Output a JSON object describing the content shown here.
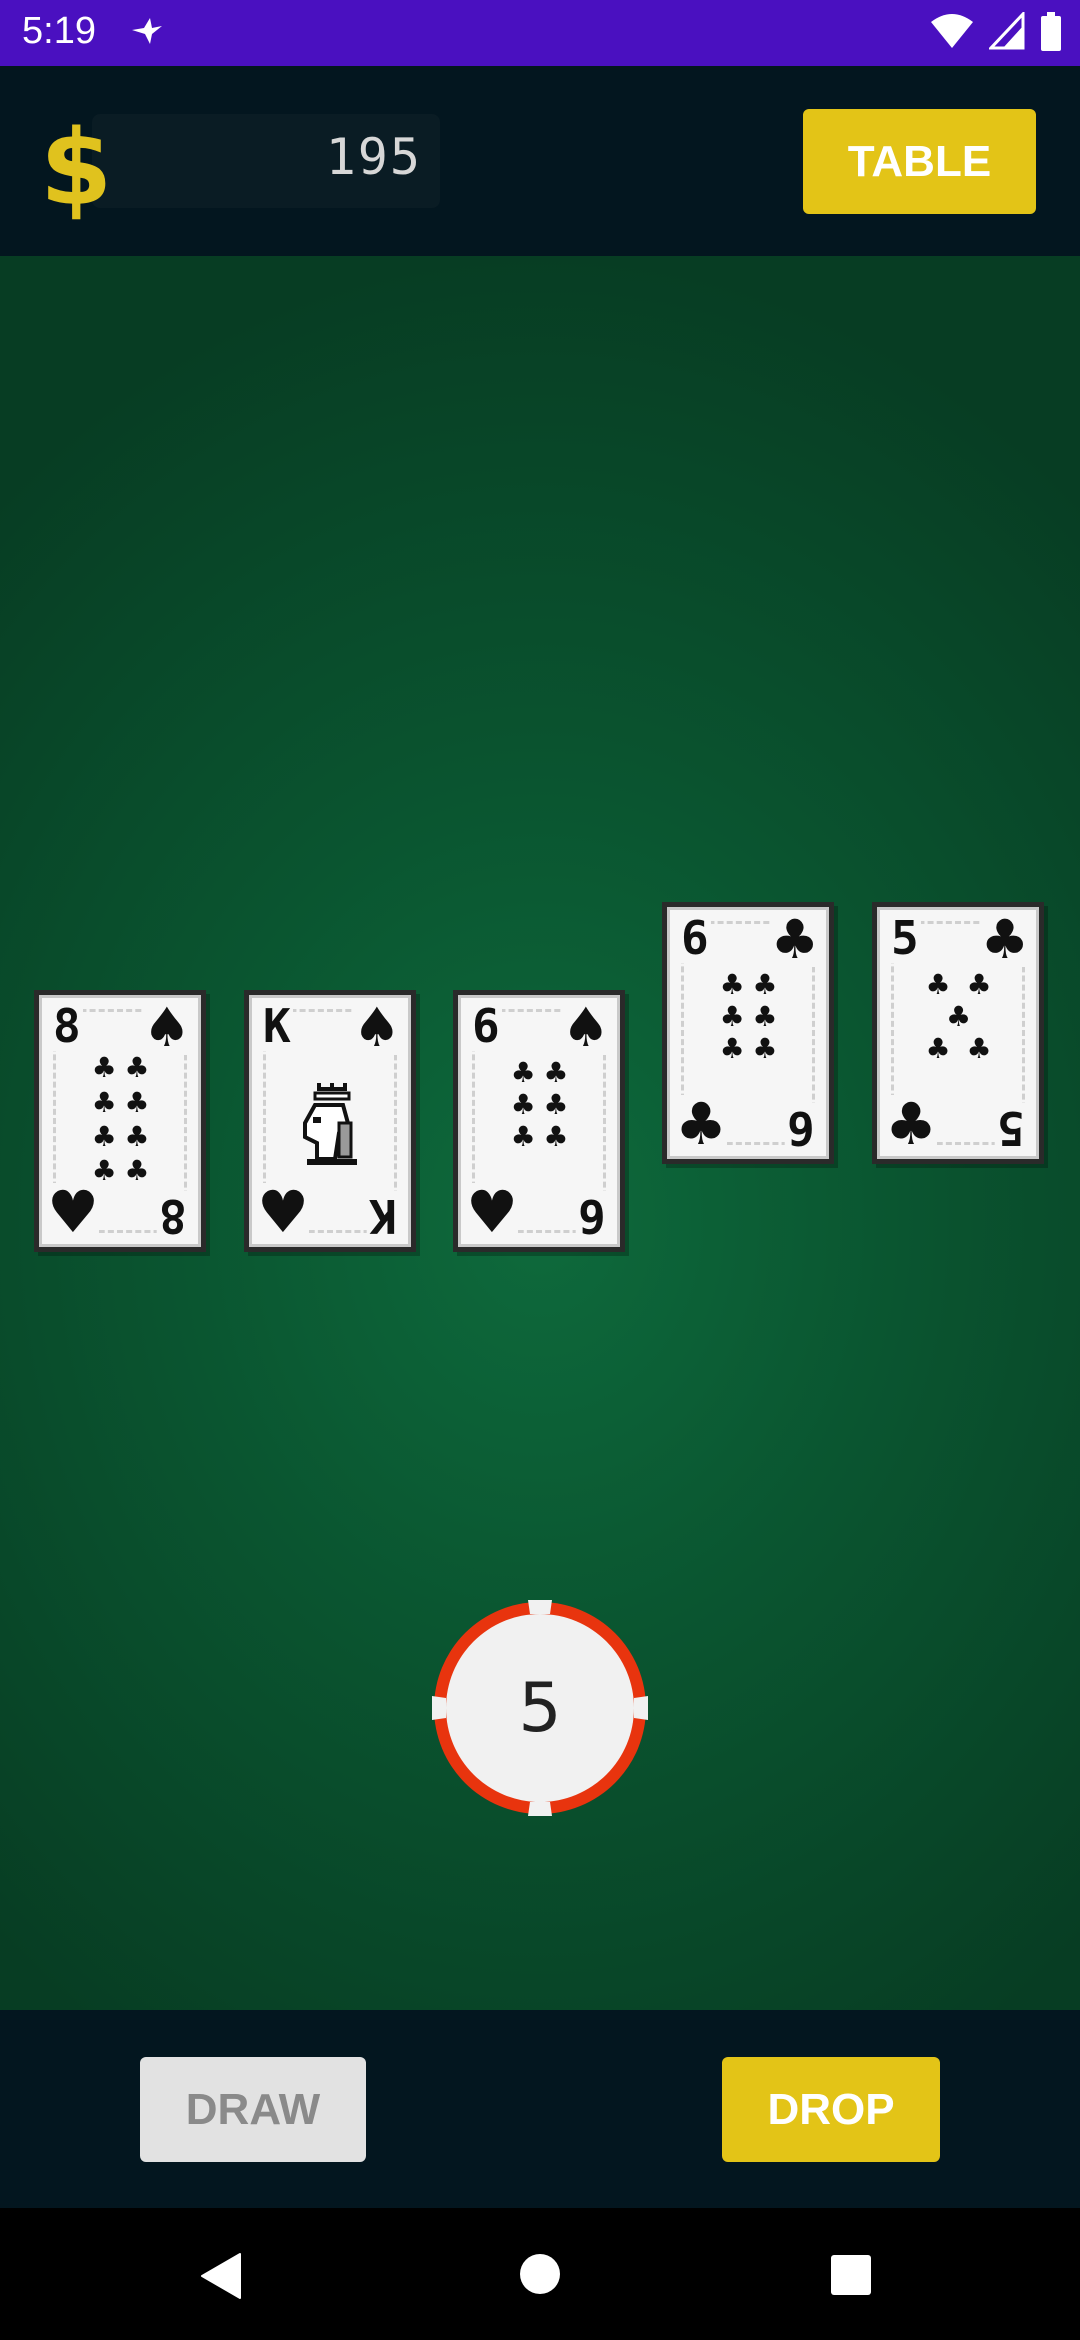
{
  "status_bar": {
    "time": "5:19",
    "icons": [
      "bird-notification-icon",
      "wifi-icon",
      "signal-icon",
      "battery-icon"
    ]
  },
  "top_bar": {
    "currency_symbol": "$",
    "balance": "195",
    "table_button_label": "TABLE"
  },
  "cards": [
    {
      "rank": "8",
      "suit": "♠",
      "bottom_suit": "♥",
      "bottom_rank": "8",
      "pips": 8
    },
    {
      "rank": "K",
      "suit": "♠",
      "bottom_suit": "♥",
      "bottom_rank": "K",
      "pips": 0
    },
    {
      "rank": "6",
      "suit": "♠",
      "bottom_suit": "♥",
      "bottom_rank": "6",
      "pips": 6
    },
    {
      "rank": "6",
      "suit": "♣",
      "bottom_suit": "♣",
      "bottom_rank": "6",
      "pips": 6
    },
    {
      "rank": "5",
      "suit": "♣",
      "bottom_suit": "♣",
      "bottom_rank": "5",
      "pips": 5
    }
  ],
  "chip": {
    "value": "5"
  },
  "controls": {
    "draw_label": "DRAW",
    "drop_label": "DROP"
  },
  "colors": {
    "accent": "#e3c417",
    "status_bar": "#4a10c0",
    "panel": "#03161f",
    "felt": "#0a5530",
    "chip_edge": "#e8340e"
  }
}
